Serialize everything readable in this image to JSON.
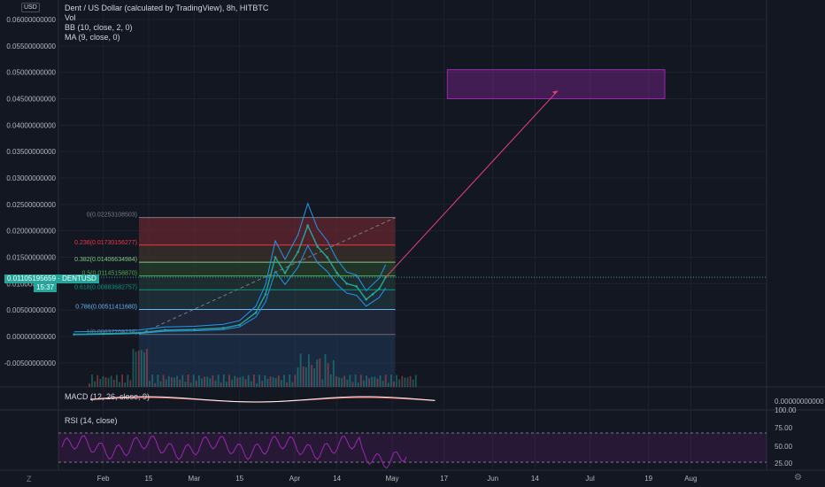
{
  "header": {
    "symbol_title": "Dent / US Dollar (calculated by TradingView), 8h, HITBTC",
    "indicators": [
      "Vol",
      "BB (10, close, 2, 0)",
      "MA (9, close, 0)"
    ],
    "currency": "USD"
  },
  "price_tag": {
    "value": "0.01105195659",
    "ticker": "DENTUSD",
    "countdown": "15:37"
  },
  "panes": {
    "macd": {
      "label": "MACD (12, 26, close, 9)",
      "axis_value": "0.00000000000"
    },
    "rsi": {
      "label": "RSI (14, close)",
      "ticks": [
        "100.00",
        "75.00",
        "50.00",
        "25.00"
      ]
    }
  },
  "footer": {
    "left_icon": "zoom-icon",
    "right_icon": "settings-icon"
  },
  "colors": {
    "background": "#131722",
    "candle_up": "#26a69a",
    "candle_down": "#ef5350",
    "bb_line": "#2196f3",
    "ma_line": "#9e9e9e",
    "target_box": "#9c27b0",
    "rsi_line": "#9c27b0",
    "macd_line": "#ffffff",
    "signal_line": "#ef5350"
  },
  "chart_data": {
    "type": "line",
    "title": "Dent / US Dollar (calculated by TradingView), 8h, HITBTC",
    "y_ticks": [
      "0.06000000000",
      "0.05500000000",
      "0.05000000000",
      "0.04500000000",
      "0.04000000000",
      "0.03500000000",
      "0.03000000000",
      "0.02500000000",
      "0.02000000000",
      "0.01500000000",
      "0.01000000000",
      "0.00500000000",
      "0.00000000000",
      "-0.00500000000"
    ],
    "ylim": [
      -0.0065,
      0.062
    ],
    "x_ticks": [
      "Feb",
      "15",
      "Mar",
      "15",
      "Apr",
      "14",
      "May",
      "17",
      "Jun",
      "14",
      "Jul",
      "19",
      "Aug"
    ],
    "series": [
      {
        "name": "DENTUSD",
        "x": [
          "2021-01-23",
          "2021-02-01",
          "2021-02-07",
          "2021-02-12",
          "2021-02-20",
          "2021-03-01",
          "2021-03-10",
          "2021-03-15",
          "2021-03-20",
          "2021-03-23",
          "2021-03-26",
          "2021-03-29",
          "2021-04-02",
          "2021-04-05",
          "2021-04-08",
          "2021-04-11",
          "2021-04-14",
          "2021-04-17",
          "2021-04-20",
          "2021-04-23",
          "2021-04-25",
          "2021-04-27",
          "2021-04-29"
        ],
        "values": [
          0.0004,
          0.0005,
          0.0006,
          0.0007,
          0.0012,
          0.0013,
          0.0016,
          0.0022,
          0.0045,
          0.008,
          0.015,
          0.012,
          0.016,
          0.021,
          0.017,
          0.015,
          0.012,
          0.01,
          0.0095,
          0.007,
          0.008,
          0.009,
          0.0112
        ]
      }
    ],
    "fibonacci": [
      {
        "ratio": "0",
        "price": "0.02253108503",
        "label": "0(0.02253108503)",
        "value": 0.02253108503
      },
      {
        "ratio": "0.236",
        "price": "0.01730156277",
        "label": "0.236(0.01730156277)",
        "value": 0.01730156277
      },
      {
        "ratio": "0.382",
        "price": "0.01406634984",
        "label": "0.382(0.01406634984)",
        "value": 0.01406634984
      },
      {
        "ratio": "0.5",
        "price": "0.01145158870",
        "label": "0.5(0.01145158870)",
        "value": 0.0114515887
      },
      {
        "ratio": "0.618",
        "price": "0.00883682757",
        "label": "0.618(0.00883682757)",
        "value": 0.00883682757
      },
      {
        "ratio": "0.786",
        "price": "0.00511411680",
        "label": "0.786(0.00511411680)",
        "value": 0.0051141168
      },
      {
        "ratio": "1",
        "price": "0.00037209238",
        "label": "1(0.00037209238)",
        "value": 0.00037209238
      }
    ],
    "target_zone": {
      "from": "2021-05-18",
      "to": "2021-07-24",
      "low": 0.045,
      "high": 0.0505
    },
    "projection": {
      "from": [
        "2021-04-29",
        0.0112
      ],
      "to": [
        "2021-06-21",
        0.0465
      ]
    },
    "rsi_levels": [
      70,
      30
    ],
    "grid": true
  }
}
